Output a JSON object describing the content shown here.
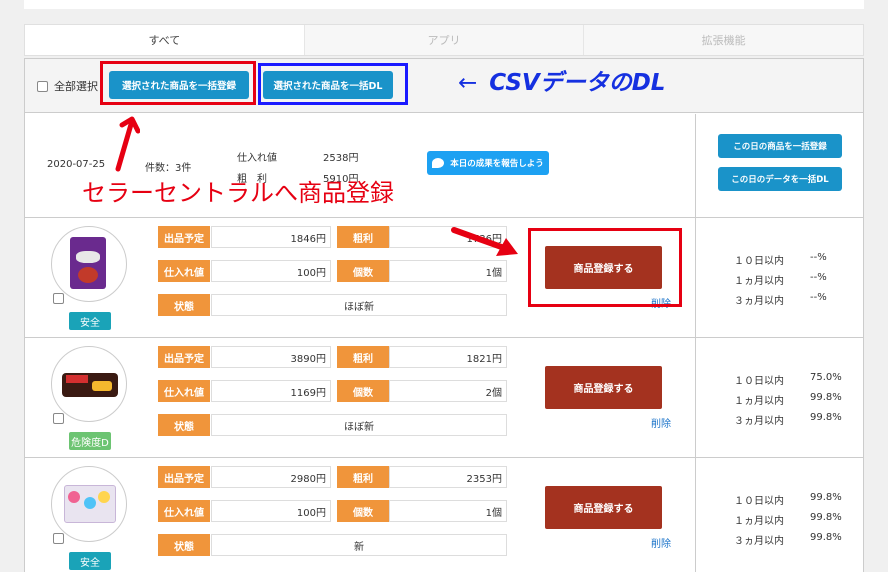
{
  "tabs": [
    "すべて",
    "アプリ",
    "拡張機能"
  ],
  "toolbar": {
    "select_all": "全部選択",
    "bulk_register": "選択された商品を一括登録",
    "bulk_download": "選択された商品を一括DL"
  },
  "annotations": {
    "csv_arrow": "←",
    "csv": "CSVデータのDL",
    "seller": "セラーセントラルへ商品登録"
  },
  "summary": {
    "date": "2020-07-25",
    "count": "件数：3件",
    "cost_label": "仕入れ値",
    "cost_value": "2538円",
    "profit_label": "粗　利",
    "profit_value": "5910円",
    "tweet": "本日の成果を報告しよう",
    "day_register": "この日の商品を一括登録",
    "day_download": "この日のデータを一括DL"
  },
  "labels": {
    "price": "出品予定",
    "profit": "粗利",
    "cost": "仕入れ値",
    "qty": "個数",
    "condition": "状態",
    "register": "商品登録する",
    "delete": "削除",
    "within_10d": "１０日以内",
    "within_1m": "１ヵ月以内",
    "within_3m": "３ヵ月以内"
  },
  "items": [
    {
      "price": "1846円",
      "profit": "1736円",
      "cost": "100円",
      "qty": "1個",
      "condition": "ほぼ新",
      "badge": "安全",
      "r10d": "--%",
      "r1m": "--%",
      "r3m": "--%"
    },
    {
      "price": "3890円",
      "profit": "1821円",
      "cost": "1169円",
      "qty": "2個",
      "condition": "ほぼ新",
      "badge": "危険度D",
      "r10d": "75.0%",
      "r1m": "99.8%",
      "r3m": "99.8%"
    },
    {
      "price": "2980円",
      "profit": "2353円",
      "cost": "100円",
      "qty": "1個",
      "condition": "新",
      "badge": "安全",
      "r10d": "99.8%",
      "r1m": "99.8%",
      "r3m": "99.8%"
    }
  ],
  "colors": {
    "label_orange": "#f0953b",
    "register_brown": "#a4321f",
    "button_blue": "#1a93c9",
    "badge_safe": "#1aa3b8",
    "badge_danger": "#6cc472",
    "annotation_red": "#e60012",
    "annotation_blue": "#1530e0"
  }
}
